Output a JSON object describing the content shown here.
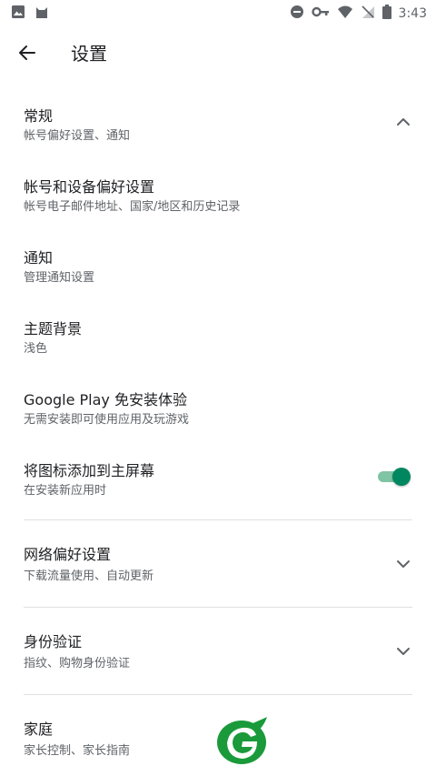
{
  "status_bar": {
    "time": "3:43",
    "left_icons": [
      "image-notification-icon",
      "cat-app-icon"
    ],
    "right_icons": [
      "dnd-icon",
      "key-icon",
      "wifi-icon",
      "no-signal-icon",
      "battery-icon"
    ]
  },
  "app_bar": {
    "title": "设置",
    "back_icon": "arrow-back-icon"
  },
  "settings": [
    {
      "title": "常规",
      "subtitle": "帐号偏好设置、通知"
    },
    {
      "title": "帐号和设备偏好设置",
      "subtitle": "帐号电子邮件地址、国家/地区和历史记录"
    },
    {
      "title": "通知",
      "subtitle": "管理通知设置"
    },
    {
      "title": "主题背景",
      "subtitle": "浅色"
    },
    {
      "title": "Google Play 免安装体验",
      "subtitle": "无需安装即可使用应用及玩游戏"
    },
    {
      "title": "将图标添加到主屏幕",
      "subtitle": "在安装新应用时",
      "toggle_on": true
    },
    {
      "title": "网络偏好设置",
      "subtitle": "下载流量使用、自动更新"
    },
    {
      "title": "身份验证",
      "subtitle": "指纹、购物身份验证"
    },
    {
      "title": "家庭",
      "subtitle": "家长控制、家长指南"
    }
  ],
  "colors": {
    "accent": "#01875f",
    "text_primary": "#202124",
    "text_secondary": "#5f6368",
    "divider": "#e0e0e0"
  }
}
